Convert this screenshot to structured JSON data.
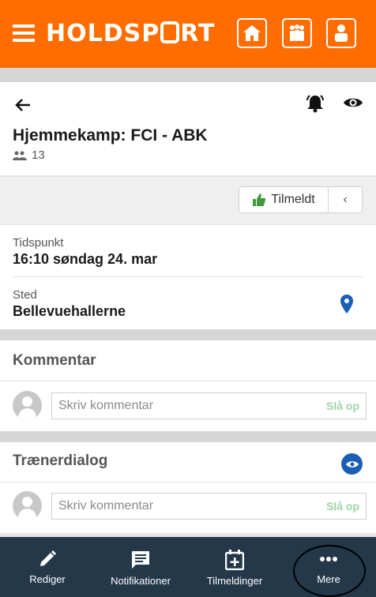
{
  "header": {
    "brand": "HOLDSPORT",
    "colors": {
      "accent": "#ff6d00",
      "nav_bg": "#24384a",
      "link_blue": "#1a5fb4"
    }
  },
  "event": {
    "title": "Hjemmekamp: FCI - ABK",
    "participants_count": "13"
  },
  "status": {
    "label": "Tilmeldt",
    "chevron": "‹"
  },
  "info": {
    "time_label": "Tidspunkt",
    "time_value": "16:10 søndag 24. mar",
    "place_label": "Sted",
    "place_value": "Bellevuehallerne"
  },
  "comments": {
    "heading": "Kommentar",
    "placeholder": "Skriv kommentar",
    "lookup_label": "Slå op"
  },
  "trainer_dialog": {
    "heading": "Trænerdialog",
    "placeholder": "Skriv kommentar",
    "lookup_label": "Slå op"
  },
  "bottom_nav": {
    "items": [
      {
        "label": "Rediger",
        "icon": "pencil-icon"
      },
      {
        "label": "Notifikationer",
        "icon": "message-icon"
      },
      {
        "label": "Tilmeldinger",
        "icon": "calendar-plus-icon"
      },
      {
        "label": "Mere",
        "icon": "more-icon"
      }
    ]
  }
}
